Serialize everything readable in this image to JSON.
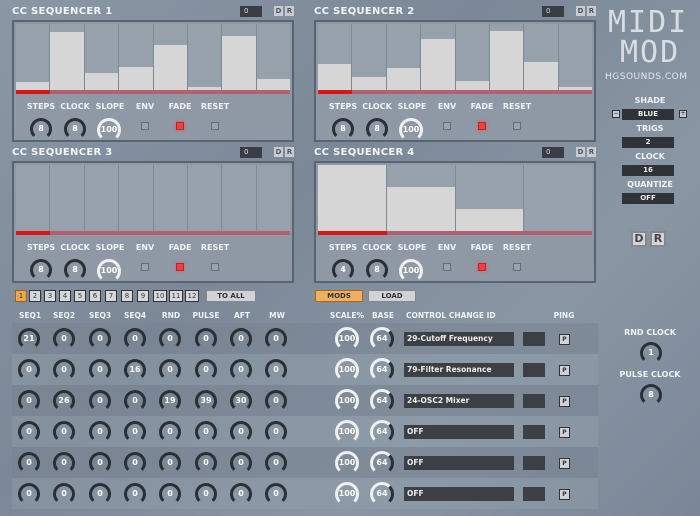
{
  "sequencers": [
    {
      "title": "CC SEQUENCER 1",
      "value": "0",
      "d_label": "D",
      "r_label": "R",
      "steps": "8",
      "clock": "8",
      "slope": "100",
      "env": false,
      "fade": true,
      "reset": false,
      "bar_values": [
        0.12,
        0.88,
        0.26,
        0.35,
        0.68,
        0.05,
        0.82,
        0.17
      ],
      "position_step": 1,
      "step_count": 8
    },
    {
      "title": "CC SEQUENCER 2",
      "value": "0",
      "d_label": "D",
      "r_label": "R",
      "steps": "8",
      "clock": "8",
      "slope": "100",
      "env": false,
      "fade": true,
      "reset": false,
      "bar_values": [
        0.4,
        0.19,
        0.33,
        0.78,
        0.14,
        0.89,
        0.42,
        0.05
      ],
      "position_step": 1,
      "step_count": 8
    },
    {
      "title": "CC SEQUENCER 3",
      "value": "0",
      "d_label": "D",
      "r_label": "R",
      "steps": "8",
      "clock": "8",
      "slope": "100",
      "env": false,
      "fade": true,
      "reset": false,
      "bar_values": [
        0,
        0,
        0,
        0,
        0,
        0,
        0,
        0
      ],
      "position_step": 1,
      "step_count": 8
    },
    {
      "title": "CC SEQUENCER 4",
      "value": "0",
      "d_label": "D",
      "r_label": "R",
      "steps": "4",
      "clock": "8",
      "slope": "100",
      "env": false,
      "fade": true,
      "reset": false,
      "bar_values": [
        1.0,
        0.67,
        0.33,
        0
      ],
      "position_step": 1,
      "step_count": 4
    }
  ],
  "control_labels": {
    "steps": "STEPS",
    "clock": "CLOCK",
    "slope": "SLOPE",
    "env": "ENV",
    "fade": "FADE",
    "reset": "RESET"
  },
  "logo": {
    "line1": "MIDI",
    "line2": "MOD",
    "url": "HGSOUNDS.COM"
  },
  "side": {
    "shade_label": "SHADE",
    "shade_value": "BLUE",
    "shade_minus": "−",
    "shade_plus": "+",
    "trigs_label": "TRIGS",
    "trigs_value": "2",
    "clock_label": "CLOCK",
    "clock_value": "16",
    "quantize_label": "QUANTIZE",
    "quantize_value": "OFF",
    "d_label": "D",
    "r_label": "R",
    "rnd_clock_label": "RND CLOCK",
    "rnd_clock_value": "1",
    "pulse_clock_label": "PULSE CLOCK",
    "pulse_clock_value": "8"
  },
  "slots": [
    "1",
    "2",
    "3",
    "4",
    "5",
    "6",
    "7",
    "8",
    "9",
    "10",
    "11",
    "12"
  ],
  "active_slot": 0,
  "buttons": {
    "to_all": "TO ALL",
    "mods": "MODS",
    "load": "LOAD"
  },
  "columns": [
    "SEQ1",
    "SEQ2",
    "SEQ3",
    "SEQ4",
    "RND",
    "PULSE",
    "AFT",
    "MW",
    "SCALE%",
    "BASE",
    "CONTROL CHANGE ID",
    "PING"
  ],
  "mod_rows": [
    {
      "values": [
        "21",
        "0",
        "0",
        "0",
        "0",
        "0",
        "0",
        "0"
      ],
      "scale": "100",
      "base": "64",
      "cc": "29-Cutoff Frequency",
      "ping": "P"
    },
    {
      "values": [
        "0",
        "0",
        "0",
        "16",
        "0",
        "0",
        "0",
        "0"
      ],
      "scale": "100",
      "base": "64",
      "cc": "79-Filter Resonance",
      "ping": "P"
    },
    {
      "values": [
        "0",
        "26",
        "0",
        "0",
        "19",
        "39",
        "30",
        "0"
      ],
      "scale": "100",
      "base": "64",
      "cc": "24-OSC2 Mixer",
      "ping": "P"
    },
    {
      "values": [
        "0",
        "0",
        "0",
        "0",
        "0",
        "0",
        "0",
        "0"
      ],
      "scale": "100",
      "base": "64",
      "cc": "OFF",
      "ping": "P"
    },
    {
      "values": [
        "0",
        "0",
        "0",
        "0",
        "0",
        "0",
        "0",
        "0"
      ],
      "scale": "100",
      "base": "64",
      "cc": "OFF",
      "ping": "P"
    },
    {
      "values": [
        "0",
        "0",
        "0",
        "0",
        "0",
        "0",
        "0",
        "0"
      ],
      "scale": "100",
      "base": "64",
      "cc": "OFF",
      "ping": "P"
    }
  ],
  "colors": {
    "accent": "#f0a850",
    "led_on": "#ff3a3a",
    "position": "#d81818"
  }
}
